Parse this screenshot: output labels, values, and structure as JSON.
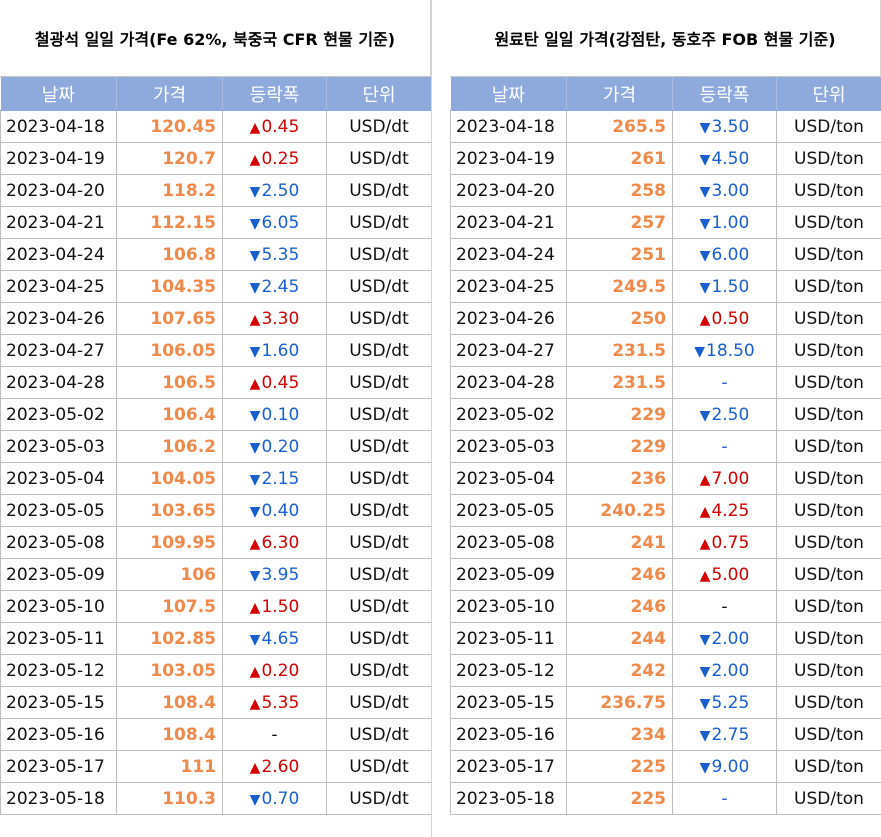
{
  "colors": {
    "header_bg": "#8ea9db",
    "price_text": "#f08a4b",
    "up": "#d40000",
    "down": "#1a5fd0"
  },
  "tables": [
    {
      "id": "iron-ore",
      "title": "철광석 일일 가격(Fe 62%, 북중국 CFR 현물 기준)",
      "headers": [
        "날짜",
        "가격",
        "등락폭",
        "단위"
      ],
      "rows": [
        {
          "date": "2023-04-18",
          "price": "120.45",
          "dir": "up",
          "change": "0.45",
          "unit": "USD/dt"
        },
        {
          "date": "2023-04-19",
          "price": "120.7",
          "dir": "up",
          "change": "0.25",
          "unit": "USD/dt"
        },
        {
          "date": "2023-04-20",
          "price": "118.2",
          "dir": "down",
          "change": "2.50",
          "unit": "USD/dt"
        },
        {
          "date": "2023-04-21",
          "price": "112.15",
          "dir": "down",
          "change": "6.05",
          "unit": "USD/dt"
        },
        {
          "date": "2023-04-24",
          "price": "106.8",
          "dir": "down",
          "change": "5.35",
          "unit": "USD/dt"
        },
        {
          "date": "2023-04-25",
          "price": "104.35",
          "dir": "down",
          "change": "2.45",
          "unit": "USD/dt"
        },
        {
          "date": "2023-04-26",
          "price": "107.65",
          "dir": "up",
          "change": "3.30",
          "unit": "USD/dt"
        },
        {
          "date": "2023-04-27",
          "price": "106.05",
          "dir": "down",
          "change": "1.60",
          "unit": "USD/dt"
        },
        {
          "date": "2023-04-28",
          "price": "106.5",
          "dir": "up",
          "change": "0.45",
          "unit": "USD/dt"
        },
        {
          "date": "2023-05-02",
          "price": "106.4",
          "dir": "down",
          "change": "0.10",
          "unit": "USD/dt"
        },
        {
          "date": "2023-05-03",
          "price": "106.2",
          "dir": "down",
          "change": "0.20",
          "unit": "USD/dt"
        },
        {
          "date": "2023-05-04",
          "price": "104.05",
          "dir": "down",
          "change": "2.15",
          "unit": "USD/dt"
        },
        {
          "date": "2023-05-05",
          "price": "103.65",
          "dir": "down",
          "change": "0.40",
          "unit": "USD/dt"
        },
        {
          "date": "2023-05-08",
          "price": "109.95",
          "dir": "up",
          "change": "6.30",
          "unit": "USD/dt"
        },
        {
          "date": "2023-05-09",
          "price": "106",
          "dir": "down",
          "change": "3.95",
          "unit": "USD/dt"
        },
        {
          "date": "2023-05-10",
          "price": "107.5",
          "dir": "up",
          "change": "1.50",
          "unit": "USD/dt"
        },
        {
          "date": "2023-05-11",
          "price": "102.85",
          "dir": "down",
          "change": "4.65",
          "unit": "USD/dt"
        },
        {
          "date": "2023-05-12",
          "price": "103.05",
          "dir": "up",
          "change": "0.20",
          "unit": "USD/dt"
        },
        {
          "date": "2023-05-15",
          "price": "108.4",
          "dir": "up",
          "change": "5.35",
          "unit": "USD/dt"
        },
        {
          "date": "2023-05-16",
          "price": "108.4",
          "dir": "flat",
          "change": "-",
          "unit": "USD/dt"
        },
        {
          "date": "2023-05-17",
          "price": "111",
          "dir": "up",
          "change": "2.60",
          "unit": "USD/dt"
        },
        {
          "date": "2023-05-18",
          "price": "110.3",
          "dir": "down",
          "change": "0.70",
          "unit": "USD/dt"
        }
      ]
    },
    {
      "id": "coking-coal",
      "title": "원료탄 일일 가격(강점탄, 동호주 FOB 현물 기준)",
      "headers": [
        "날짜",
        "가격",
        "등락폭",
        "단위"
      ],
      "rows": [
        {
          "date": "2023-04-18",
          "price": "265.5",
          "dir": "down",
          "change": "3.50",
          "unit": "USD/ton"
        },
        {
          "date": "2023-04-19",
          "price": "261",
          "dir": "down",
          "change": "4.50",
          "unit": "USD/ton"
        },
        {
          "date": "2023-04-20",
          "price": "258",
          "dir": "down",
          "change": "3.00",
          "unit": "USD/ton"
        },
        {
          "date": "2023-04-21",
          "price": "257",
          "dir": "down",
          "change": "1.00",
          "unit": "USD/ton"
        },
        {
          "date": "2023-04-24",
          "price": "251",
          "dir": "down",
          "change": "6.00",
          "unit": "USD/ton"
        },
        {
          "date": "2023-04-25",
          "price": "249.5",
          "dir": "down",
          "change": "1.50",
          "unit": "USD/ton"
        },
        {
          "date": "2023-04-26",
          "price": "250",
          "dir": "up",
          "change": "0.50",
          "unit": "USD/ton"
        },
        {
          "date": "2023-04-27",
          "price": "231.5",
          "dir": "down",
          "change": "18.50",
          "unit": "USD/ton"
        },
        {
          "date": "2023-04-28",
          "price": "231.5",
          "dir": "flat-blue",
          "change": "-",
          "unit": "USD/ton"
        },
        {
          "date": "2023-05-02",
          "price": "229",
          "dir": "down",
          "change": "2.50",
          "unit": "USD/ton"
        },
        {
          "date": "2023-05-03",
          "price": "229",
          "dir": "flat-blue",
          "change": "-",
          "unit": "USD/ton"
        },
        {
          "date": "2023-05-04",
          "price": "236",
          "dir": "up",
          "change": "7.00",
          "unit": "USD/ton"
        },
        {
          "date": "2023-05-05",
          "price": "240.25",
          "dir": "up",
          "change": "4.25",
          "unit": "USD/ton"
        },
        {
          "date": "2023-05-08",
          "price": "241",
          "dir": "up",
          "change": "0.75",
          "unit": "USD/ton"
        },
        {
          "date": "2023-05-09",
          "price": "246",
          "dir": "up",
          "change": "5.00",
          "unit": "USD/ton"
        },
        {
          "date": "2023-05-10",
          "price": "246",
          "dir": "flat",
          "change": "-",
          "unit": "USD/ton"
        },
        {
          "date": "2023-05-11",
          "price": "244",
          "dir": "down",
          "change": "2.00",
          "unit": "USD/ton"
        },
        {
          "date": "2023-05-12",
          "price": "242",
          "dir": "down",
          "change": "2.00",
          "unit": "USD/ton"
        },
        {
          "date": "2023-05-15",
          "price": "236.75",
          "dir": "down",
          "change": "5.25",
          "unit": "USD/ton"
        },
        {
          "date": "2023-05-16",
          "price": "234",
          "dir": "down",
          "change": "2.75",
          "unit": "USD/ton"
        },
        {
          "date": "2023-05-17",
          "price": "225",
          "dir": "down",
          "change": "9.00",
          "unit": "USD/ton"
        },
        {
          "date": "2023-05-18",
          "price": "225",
          "dir": "flat-blue",
          "change": "-",
          "unit": "USD/ton"
        }
      ]
    }
  ]
}
